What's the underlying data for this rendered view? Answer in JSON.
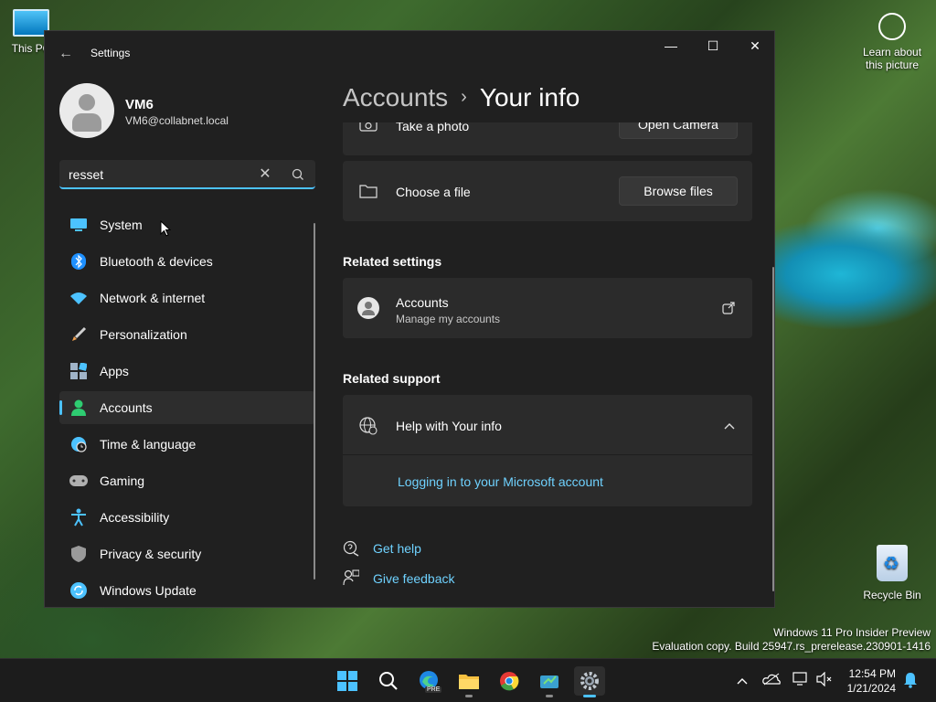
{
  "desktop": {
    "this_pc_label": "This PC",
    "learn_label": "Learn about this picture",
    "recycle_label": "Recycle Bin",
    "watermark_line1": "Windows 11 Pro Insider Preview",
    "watermark_line2": "Evaluation copy. Build 25947.rs_prerelease.230901-1416"
  },
  "window": {
    "title": "Settings",
    "back_glyph": "←",
    "minimize_glyph": "—",
    "maximize_glyph": "☐",
    "close_glyph": "✕"
  },
  "profile": {
    "name": "VM6",
    "email": "VM6@collabnet.local"
  },
  "search": {
    "value": "resset",
    "clear_glyph": "✕"
  },
  "nav": {
    "items": [
      {
        "label": "System",
        "icon": "system-icon",
        "color": "#4cc2ff"
      },
      {
        "label": "Bluetooth & devices",
        "icon": "bluetooth-icon",
        "color": "#1e90ff"
      },
      {
        "label": "Network & internet",
        "icon": "wifi-icon",
        "color": "#4cc2ff"
      },
      {
        "label": "Personalization",
        "icon": "brush-icon",
        "color": "#f0a050"
      },
      {
        "label": "Apps",
        "icon": "apps-icon",
        "color": "#a0b4c8"
      },
      {
        "label": "Accounts",
        "icon": "person-icon",
        "color": "#2ecc71",
        "active": true
      },
      {
        "label": "Time & language",
        "icon": "clock-globe-icon",
        "color": "#4cc2ff"
      },
      {
        "label": "Gaming",
        "icon": "gamepad-icon",
        "color": "#b0b0b0"
      },
      {
        "label": "Accessibility",
        "icon": "accessibility-icon",
        "color": "#4cc2ff"
      },
      {
        "label": "Privacy & security",
        "icon": "shield-icon",
        "color": "#9a9a9a"
      },
      {
        "label": "Windows Update",
        "icon": "update-icon",
        "color": "#4cc2ff"
      }
    ]
  },
  "breadcrumb": {
    "parent": "Accounts",
    "separator": "›",
    "current": "Your info"
  },
  "content": {
    "take_photo_label": "Take a photo",
    "open_camera_label": "Open Camera",
    "choose_file_label": "Choose a file",
    "browse_files_label": "Browse files",
    "related_settings_title": "Related settings",
    "accounts_link_title": "Accounts",
    "accounts_link_sub": "Manage my accounts",
    "related_support_title": "Related support",
    "help_title": "Help with Your info",
    "help_link": "Logging in to your Microsoft account",
    "get_help": "Get help",
    "give_feedback": "Give feedback"
  },
  "taskbar": {
    "time": "12:54 PM",
    "date": "1/21/2024",
    "edge_badge": "PRE"
  },
  "colors": {
    "accent": "#4cc2ff",
    "link": "#6fd2ff",
    "window_bg": "#202020",
    "card_bg": "#2b2b2b"
  }
}
